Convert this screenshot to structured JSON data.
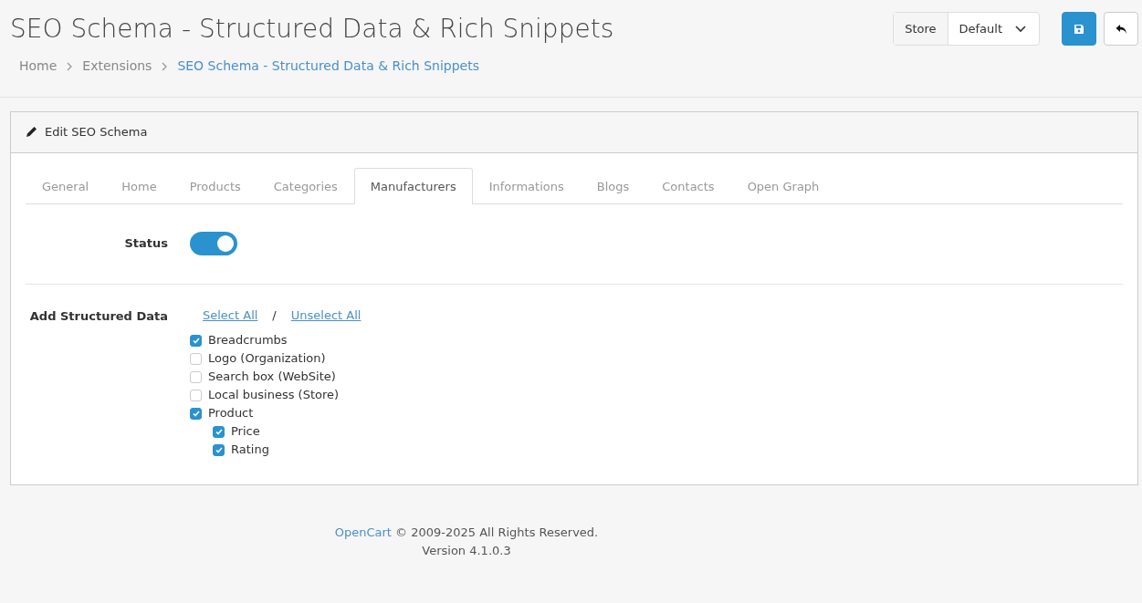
{
  "page_title": "SEO Schema - Structured Data & Rich Snippets",
  "breadcrumbs": [
    {
      "label": "Home",
      "active": false
    },
    {
      "label": "Extensions",
      "active": false
    },
    {
      "label": "SEO Schema - Structured Data & Rich Snippets",
      "active": true
    }
  ],
  "store_selector": {
    "label": "Store",
    "value": "Default"
  },
  "card_title": "Edit SEO Schema",
  "tabs": [
    {
      "label": "General",
      "selected": false
    },
    {
      "label": "Home",
      "selected": false
    },
    {
      "label": "Products",
      "selected": false
    },
    {
      "label": "Categories",
      "selected": false
    },
    {
      "label": "Manufacturers",
      "selected": true
    },
    {
      "label": "Informations",
      "selected": false
    },
    {
      "label": "Blogs",
      "selected": false
    },
    {
      "label": "Contacts",
      "selected": false
    },
    {
      "label": "Open Graph",
      "selected": false
    }
  ],
  "status": {
    "label": "Status",
    "on": true
  },
  "structured_data": {
    "label": "Add Structured Data",
    "select_all": "Select All",
    "separator": "/",
    "unselect_all": "Unselect All",
    "options": [
      {
        "label": "Breadcrumbs",
        "checked": true
      },
      {
        "label": "Logo (Organization)",
        "checked": false
      },
      {
        "label": "Search box (WebSite)",
        "checked": false
      },
      {
        "label": "Local business (Store)",
        "checked": false
      },
      {
        "label": "Product",
        "checked": true,
        "children": [
          {
            "label": "Price",
            "checked": true
          },
          {
            "label": "Rating",
            "checked": true
          }
        ]
      }
    ]
  },
  "footer": {
    "link": "OpenCart",
    "text": " © 2009-2025 All Rights Reserved.",
    "version": "Version 4.1.0.3"
  }
}
